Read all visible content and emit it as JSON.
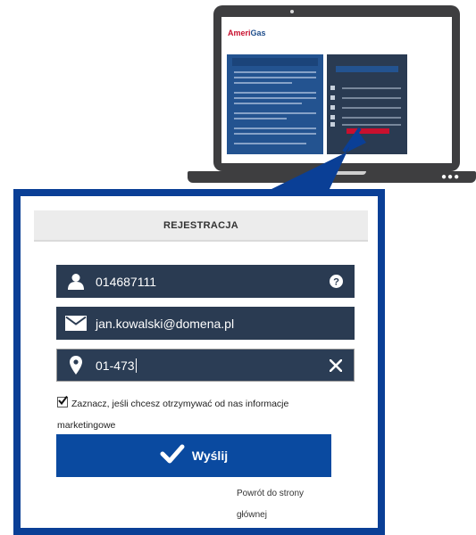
{
  "mini_site": {
    "logo_left": "Ameri",
    "logo_right": "Gas"
  },
  "form": {
    "title": "REJESTRACJA",
    "customer_number": {
      "value": "014687111"
    },
    "email": {
      "value": "jan.kowalski@domena.pl"
    },
    "postal_code": {
      "value": "01-473"
    },
    "consent": {
      "checked": true,
      "line1": "Zaznacz, jeśli chcesz otrzymywać od nas informacje",
      "line2": "marketingowe"
    },
    "submit_label": "Wyślij",
    "back_link": {
      "line1": "Powrót do strony",
      "line2": "głównej"
    }
  },
  "icons": [
    "user-icon",
    "help-icon",
    "envelope-icon",
    "location-pin-icon",
    "clear-icon",
    "checkmark-icon"
  ],
  "colors": {
    "panel_border": "#0a3f96",
    "field_bg": "#2a3b52",
    "button_bg": "#0a4aa0",
    "brand_red": "#c8102e"
  }
}
